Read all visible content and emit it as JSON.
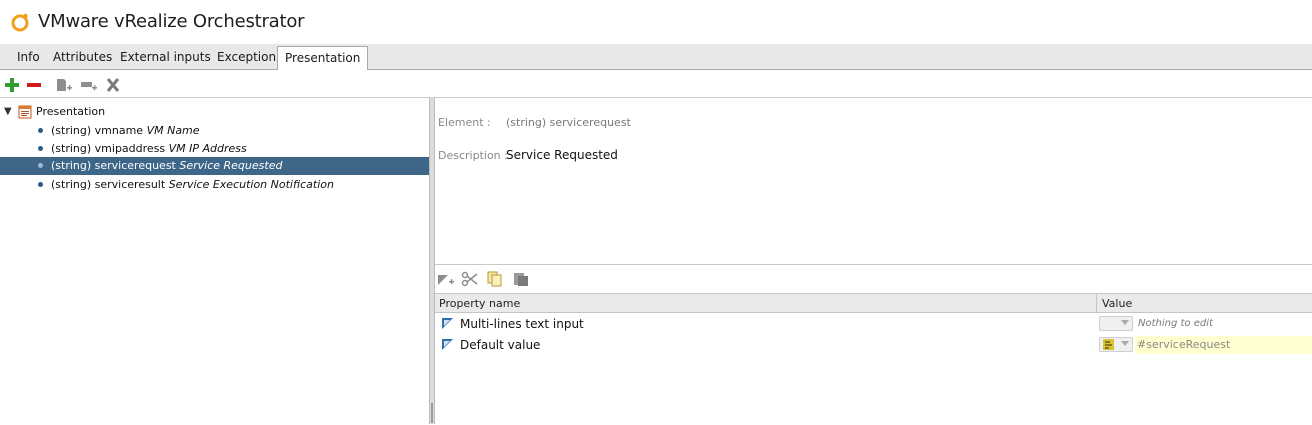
{
  "app": {
    "title": "VMware vRealize Orchestrator"
  },
  "tabs": [
    {
      "label": "Info"
    },
    {
      "label": "Attributes"
    },
    {
      "label": "External inputs"
    },
    {
      "label": "Exception"
    },
    {
      "label": "Presentation",
      "active": true
    }
  ],
  "toolbar": {
    "icons": [
      "add-icon",
      "remove-icon",
      "new-step-icon",
      "new-input-icon",
      "delete-icon"
    ]
  },
  "tree": {
    "root": {
      "label": "Presentation"
    },
    "items": [
      {
        "type": "(string) vmname",
        "desc": "VM Name"
      },
      {
        "type": "(string) vmipaddress",
        "desc": "VM IP Address"
      },
      {
        "type": "(string) servicerequest",
        "desc": "Service Requested",
        "selected": true
      },
      {
        "type": "(string) serviceresult",
        "desc": "Service Execution Notification"
      }
    ]
  },
  "details": {
    "element_label": "Element :",
    "element_value": "(string) servicerequest",
    "description_label": "Description :",
    "description_value": "Service Requested"
  },
  "properties": {
    "header": {
      "name": "Property name",
      "value": "Value"
    },
    "rows": [
      {
        "name": "Multi-lines text input",
        "value": "Nothing to edit"
      },
      {
        "name": "Default value",
        "value": "#serviceRequest"
      }
    ]
  },
  "colors": {
    "selection": "#3d6689",
    "add": "#2e9e2e",
    "remove": "#d11a1a",
    "bind_field": "#ffffd0"
  }
}
